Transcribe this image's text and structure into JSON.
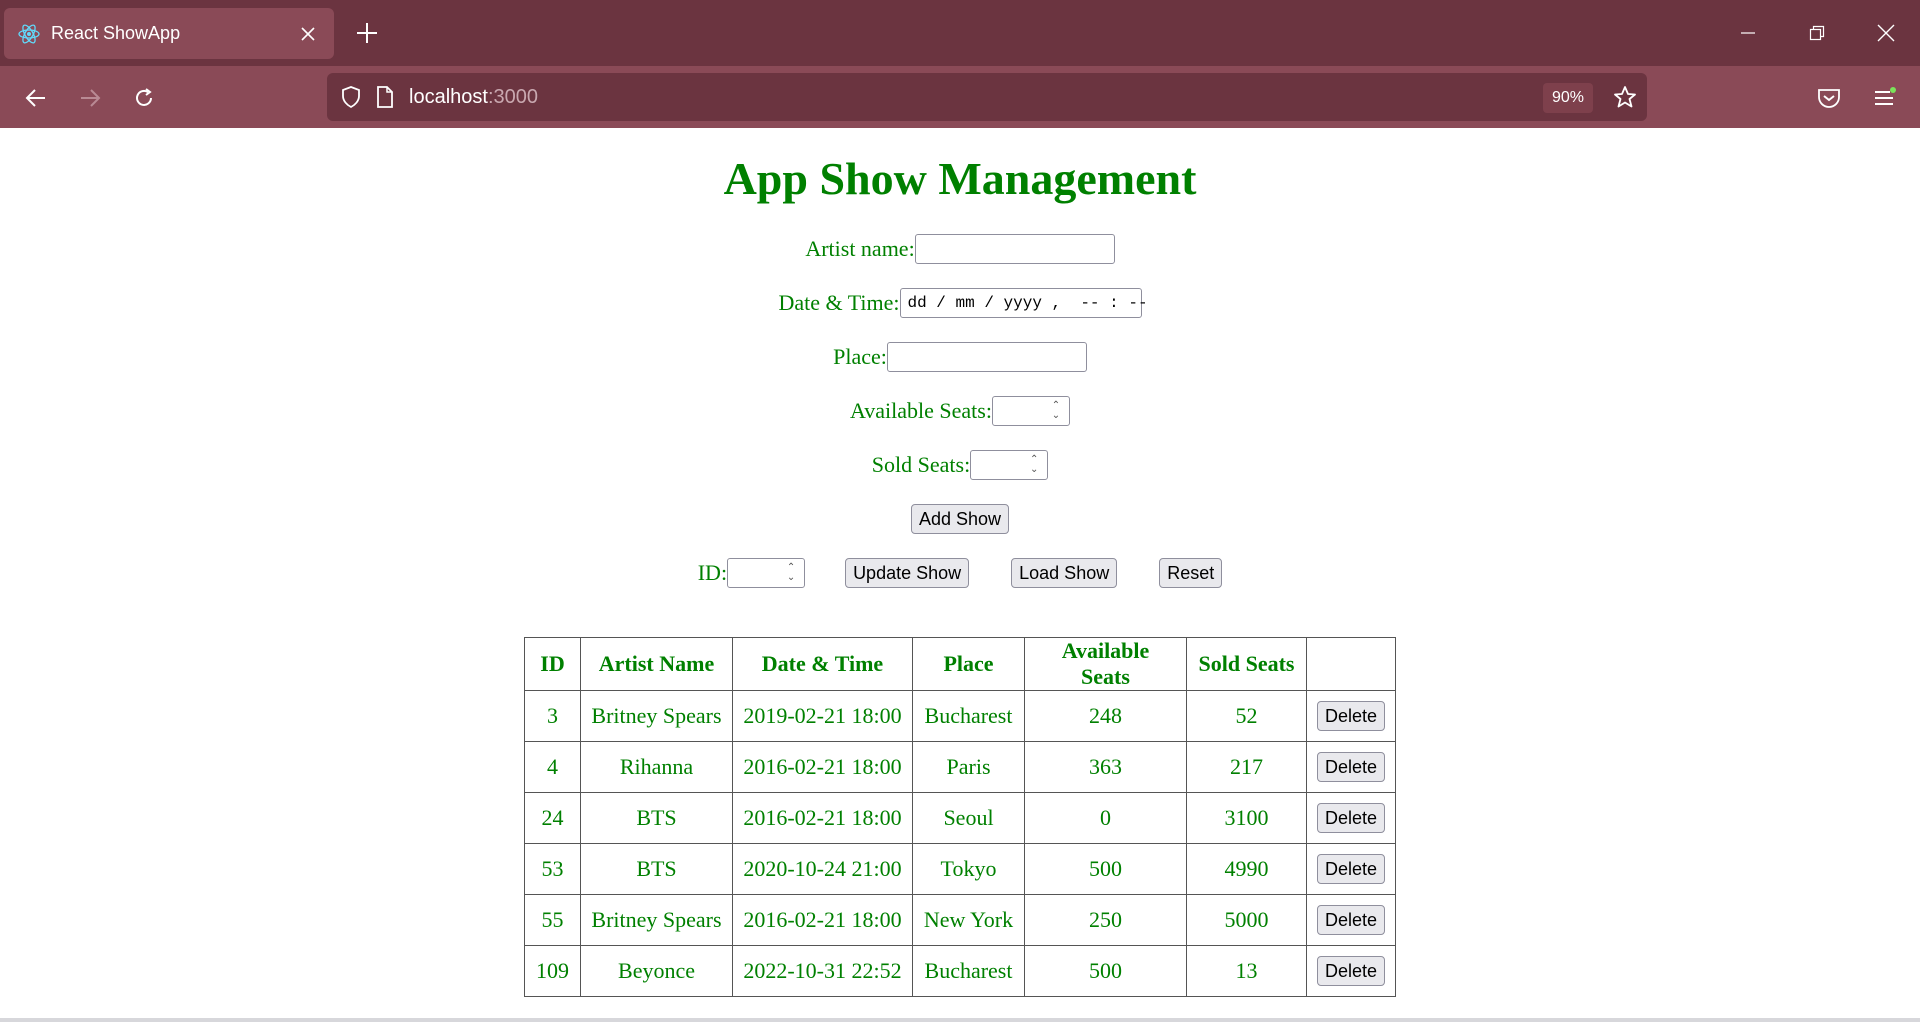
{
  "browser": {
    "tab_title": "React ShowApp",
    "url_host": "localhost",
    "url_port": ":3000",
    "zoom": "90%",
    "favicon": "react-logo-icon"
  },
  "page": {
    "title": "App Show Management",
    "form": {
      "artist_label": "Artist name:",
      "artist_value": "",
      "datetime_label": "Date & Time:",
      "datetime_placeholder": "dd / mm / yyyy ,  -- : --",
      "place_label": "Place:",
      "place_value": "",
      "available_label": "Available Seats:",
      "sold_label": "Sold Seats:",
      "add_button": "Add Show",
      "id_label": "ID:",
      "update_button": "Update Show",
      "load_button": "Load Show",
      "reset_button": "Reset"
    },
    "table": {
      "headers": [
        "ID",
        "Artist Name",
        "Date & Time",
        "Place",
        "Available Seats",
        "Sold Seats",
        ""
      ],
      "delete_label": "Delete",
      "rows": [
        {
          "id": "3",
          "artist": "Britney Spears",
          "datetime": "2019-02-21 18:00",
          "place": "Bucharest",
          "available": "248",
          "sold": "52"
        },
        {
          "id": "4",
          "artist": "Rihanna",
          "datetime": "2016-02-21 18:00",
          "place": "Paris",
          "available": "363",
          "sold": "217"
        },
        {
          "id": "24",
          "artist": "BTS",
          "datetime": "2016-02-21 18:00",
          "place": "Seoul",
          "available": "0",
          "sold": "3100"
        },
        {
          "id": "53",
          "artist": "BTS",
          "datetime": "2020-10-24 21:00",
          "place": "Tokyo",
          "available": "500",
          "sold": "4990"
        },
        {
          "id": "55",
          "artist": "Britney Spears",
          "datetime": "2016-02-21 18:00",
          "place": "New York",
          "available": "250",
          "sold": "5000"
        },
        {
          "id": "109",
          "artist": "Beyonce",
          "datetime": "2022-10-31 22:52",
          "place": "Bucharest",
          "available": "500",
          "sold": "13"
        }
      ]
    }
  },
  "colors": {
    "accent_green": "#008000",
    "chrome_dark": "#6b3440",
    "chrome_light": "#8a4a57"
  }
}
